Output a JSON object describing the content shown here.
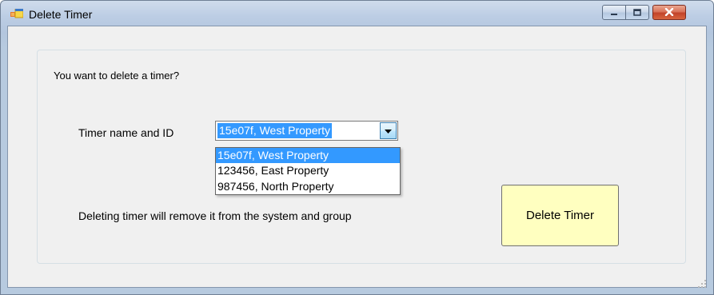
{
  "window": {
    "title": "Delete Timer",
    "title_icon": "app-window-icon",
    "controls": [
      "minimize-icon",
      "maximize-icon",
      "close-icon"
    ]
  },
  "group": {
    "legend": "You want to delete a timer?"
  },
  "timer_field": {
    "label": "Timer name and ID",
    "selected_value": "15e07f, West Property",
    "options": [
      "15e07f, West Property",
      "123456, East Property",
      "987456, North Property"
    ],
    "expanded": true
  },
  "warning_text": "Deleting timer will remove it from the system and group",
  "actions": {
    "delete_label": "Delete Timer"
  },
  "colors": {
    "selection": "#3399ff",
    "delete_button_bg": "#ffffc0",
    "close_button": "#c9452c"
  }
}
